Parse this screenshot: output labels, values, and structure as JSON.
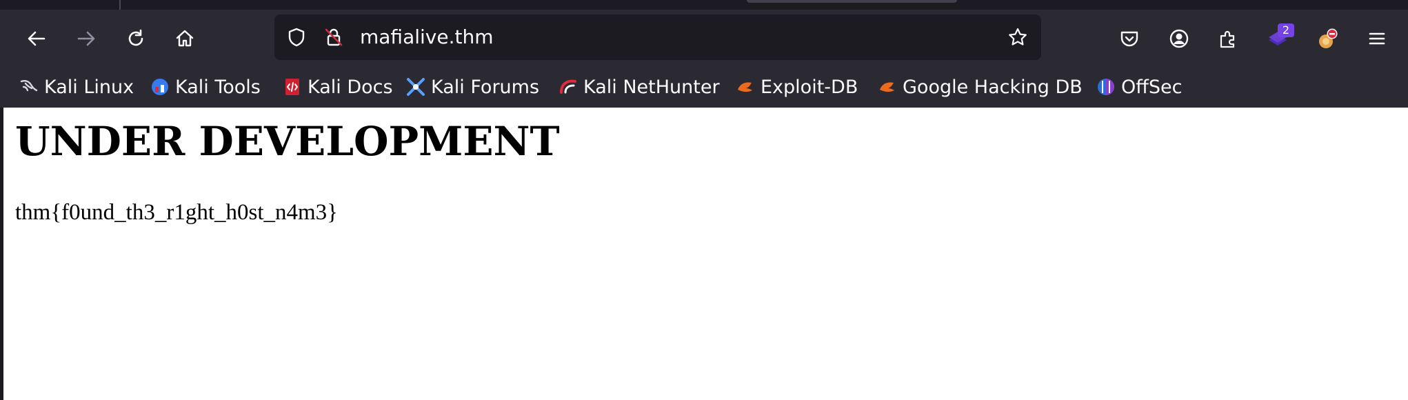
{
  "browser": {
    "url": "mafialive.thm",
    "extension_badge": "2"
  },
  "bookmarks": [
    {
      "label": "Kali Linux",
      "icon": "kali-dragon-icon"
    },
    {
      "label": "Kali Tools",
      "icon": "kali-tools-icon"
    },
    {
      "label": "Kali Docs",
      "icon": "kali-docs-icon"
    },
    {
      "label": "Kali Forums",
      "icon": "kali-forums-icon"
    },
    {
      "label": "Kali NetHunter",
      "icon": "kali-nethunter-icon"
    },
    {
      "label": "Exploit-DB",
      "icon": "exploit-db-icon"
    },
    {
      "label": "Google Hacking DB",
      "icon": "ghdb-icon"
    },
    {
      "label": "OffSec",
      "icon": "offsec-icon"
    }
  ],
  "page": {
    "heading": "UNDER DEVELOPMENT",
    "text": "thm{f0und_th3_r1ght_h0st_n4m3}"
  },
  "colors": {
    "toolbar": "#2b2a33",
    "urlbar": "#1c1b22",
    "toolbar_text": "#fbfbfe",
    "extension_purple": "#6a3fd1",
    "block_red": "#e0293c"
  }
}
